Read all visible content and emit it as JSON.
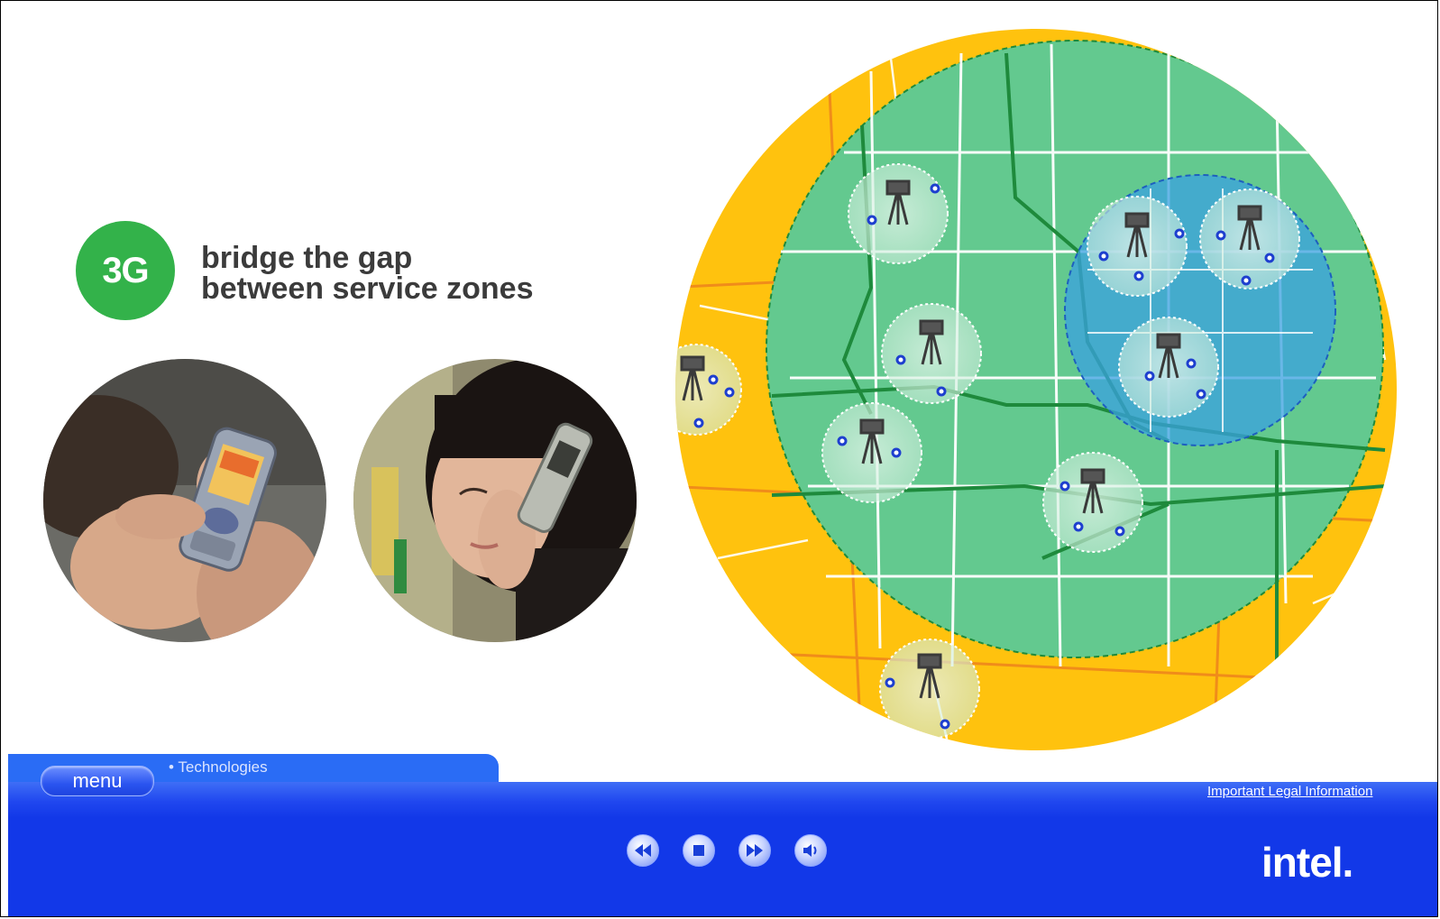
{
  "badge": {
    "text": "3G",
    "color": "#33b24a"
  },
  "headline": {
    "line1": "bridge the gap",
    "line2": "between service zones"
  },
  "footer": {
    "menu_label": "menu",
    "breadcrumb": "• Technologies",
    "legal_link": "Important Legal Information",
    "logo": "intel."
  },
  "controls": [
    {
      "name": "rewind-button",
      "icon": "rewind-icon"
    },
    {
      "name": "stop-button",
      "icon": "stop-icon"
    },
    {
      "name": "fast-forward-button",
      "icon": "fast-forward-icon"
    },
    {
      "name": "volume-button",
      "icon": "volume-icon"
    }
  ],
  "colors": {
    "coverage_outer": "#ffc20e",
    "coverage_3g": "#5fc88a",
    "coverage_hotspot": "#3aa0e0",
    "footer_blue": "#1238e8"
  }
}
